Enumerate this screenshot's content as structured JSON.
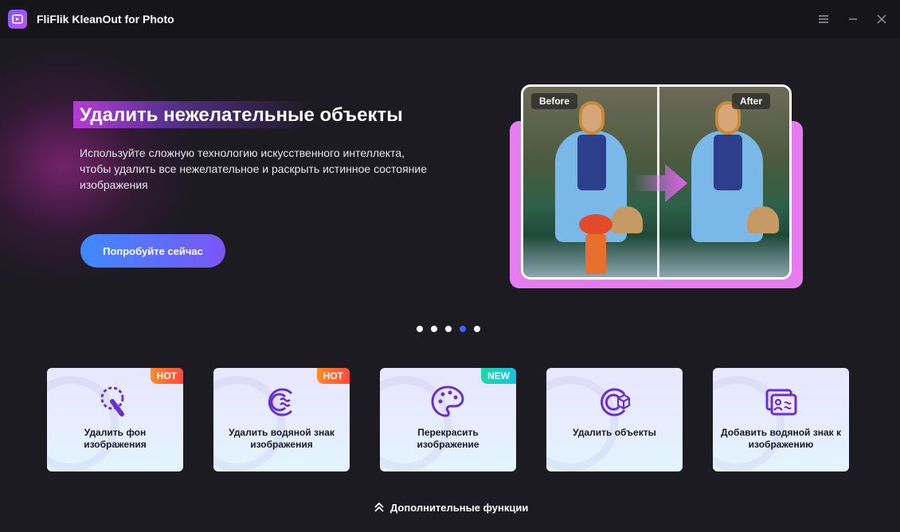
{
  "app": {
    "title": "FliFlik KleanOut for Photo"
  },
  "window_controls": {
    "menu_icon": "menu-icon",
    "minimize_icon": "minimize-icon",
    "close_icon": "close-icon"
  },
  "banner": {
    "headline": "Удалить нежелательные объекты",
    "description": "Используйте сложную технологию искусственного интеллекта, чтобы удалить все нежелательное и раскрыть истинное состояние изображения",
    "cta_label": "Попробуйте сейчас",
    "preview": {
      "before_label": "Before",
      "after_label": "After"
    }
  },
  "carousel": {
    "dot_count": 5,
    "active_index": 3
  },
  "features": [
    {
      "label": "Удалить фон изображения",
      "badge": "HOT",
      "icon": "remove-background-icon"
    },
    {
      "label": "Удалить водяной знак изображения",
      "badge": "HOT",
      "icon": "remove-watermark-icon"
    },
    {
      "label": "Перекрасить изображение",
      "badge": "NEW",
      "icon": "palette-icon"
    },
    {
      "label": "Удалить объекты",
      "badge": "",
      "icon": "remove-object-icon"
    },
    {
      "label": "Добавить водяной знак к изображению",
      "badge": "",
      "icon": "add-watermark-icon"
    }
  ],
  "more_features_label": "Дополнительные функции",
  "colors": {
    "background": "#1b1b21",
    "titlebar": "#15151a",
    "accent_purple": "#7b4fe0",
    "dot_active": "#4a5cff",
    "hot_badge": "#ff5a36",
    "new_badge": "#1fd0b8",
    "preview_frame": "#e77cf0"
  }
}
